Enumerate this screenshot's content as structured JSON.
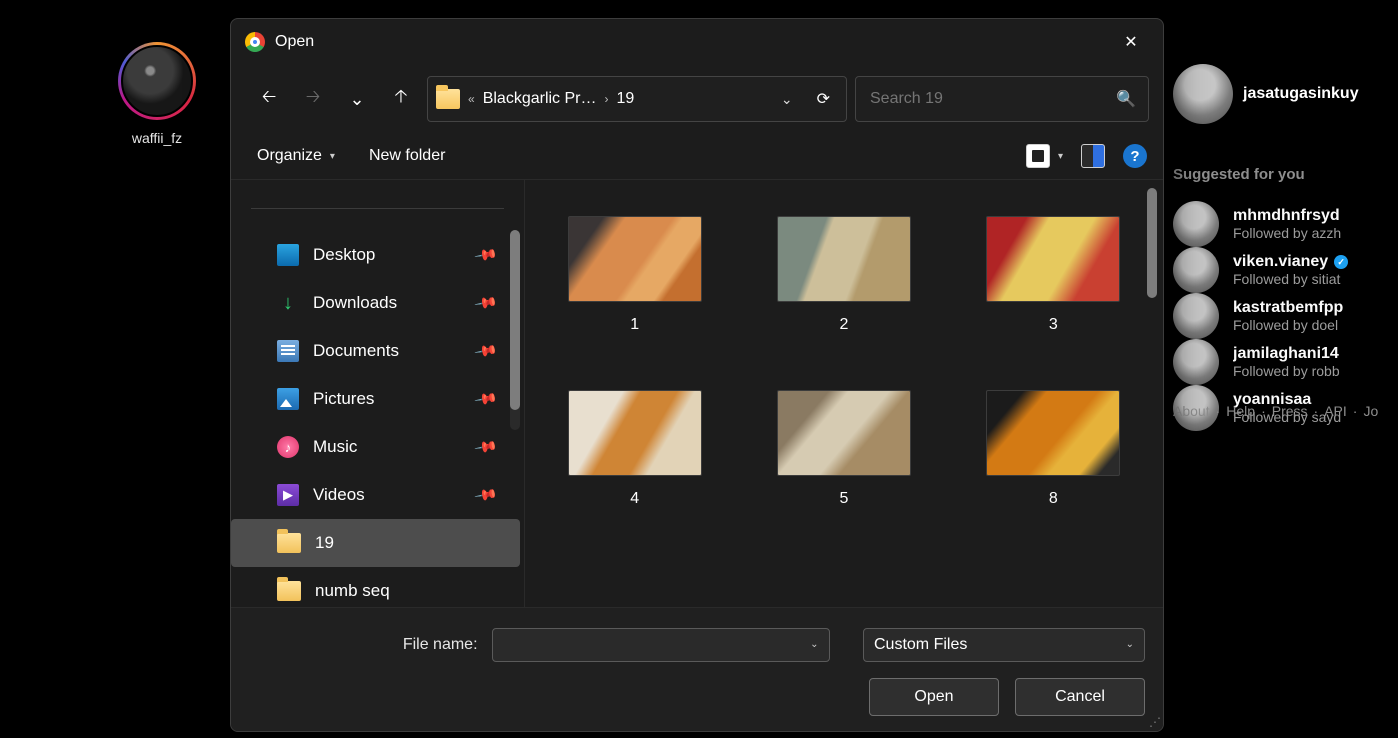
{
  "background": {
    "story_label": "waffii_fz",
    "top_account": "jasatugasinkuy",
    "suggested_title": "Suggested for you",
    "suggestions": [
      {
        "name": "mhmdhnfrsyd",
        "sub": "Followed by azzh",
        "verified": false
      },
      {
        "name": "viken.vianey",
        "sub": "Followed by sitiat",
        "verified": true
      },
      {
        "name": "kastratbemfpp",
        "sub": "Followed by doel",
        "verified": false
      },
      {
        "name": "jamilaghani14",
        "sub": "Followed by robb",
        "verified": false
      },
      {
        "name": "yoannisaa",
        "sub": "Followed by sayd",
        "verified": false
      }
    ],
    "footer_links": [
      "About",
      "Help",
      "Press",
      "API",
      "Jo"
    ]
  },
  "dialog": {
    "title": "Open",
    "breadcrumbs": {
      "parent": "Blackgarlic Pr…",
      "current": "19"
    },
    "search_placeholder": "Search 19",
    "toolbar": {
      "organize": "Organize",
      "new_folder": "New folder",
      "help": "?"
    },
    "tree": [
      {
        "id": "desktop",
        "label": "Desktop",
        "icon": "desktop",
        "pinned": true
      },
      {
        "id": "downloads",
        "label": "Downloads",
        "icon": "dl",
        "pinned": true
      },
      {
        "id": "documents",
        "label": "Documents",
        "icon": "doc",
        "pinned": true
      },
      {
        "id": "pictures",
        "label": "Pictures",
        "icon": "pic",
        "pinned": true
      },
      {
        "id": "music",
        "label": "Music",
        "icon": "music",
        "pinned": true
      },
      {
        "id": "videos",
        "label": "Videos",
        "icon": "vid",
        "pinned": true
      },
      {
        "id": "19",
        "label": "19",
        "icon": "folder",
        "pinned": false,
        "selected": true
      },
      {
        "id": "numbseq",
        "label": "numb seq",
        "icon": "folder",
        "pinned": false
      }
    ],
    "files": [
      {
        "name": "1",
        "thumb": "t1"
      },
      {
        "name": "2",
        "thumb": "t2"
      },
      {
        "name": "3",
        "thumb": "t3"
      },
      {
        "name": "4",
        "thumb": "t4"
      },
      {
        "name": "5",
        "thumb": "t5"
      },
      {
        "name": "8",
        "thumb": "t6"
      }
    ],
    "file_name_label": "File name:",
    "file_name_value": "",
    "file_type_value": "Custom Files",
    "buttons": {
      "open": "Open",
      "cancel": "Cancel"
    }
  }
}
